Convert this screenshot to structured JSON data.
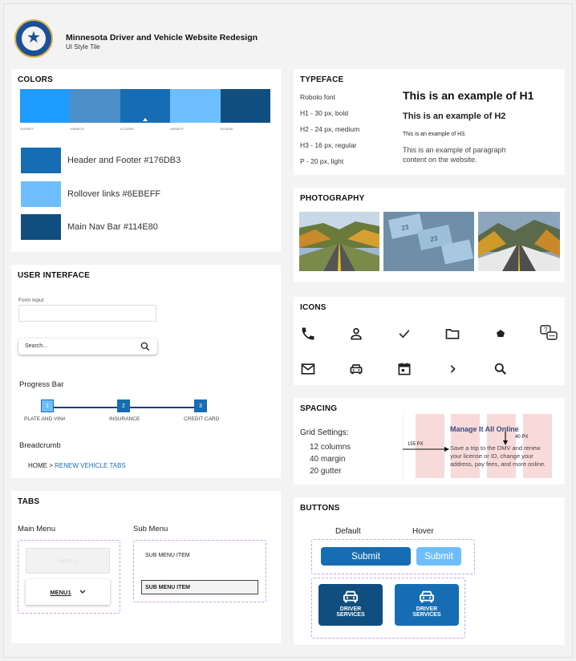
{
  "header": {
    "title": "Minnesota Driver and Vehicle Website Redesign",
    "subtitle": "UI Style Tile"
  },
  "colors": {
    "heading": "COLORS",
    "palette": [
      {
        "hex": "#1E9BFF",
        "label": "#1E9BFF"
      },
      {
        "hex": "#4B8EC8",
        "label": "#4B8EC8"
      },
      {
        "hex": "#176DB3",
        "label": "#176DB3"
      },
      {
        "hex": "#6EBEFF",
        "label": "#6EBEFF"
      },
      {
        "hex": "#114E80",
        "label": "#114E80"
      }
    ],
    "legend": [
      {
        "hex": "#176DB3",
        "label": "Header and Footer #176DB3"
      },
      {
        "hex": "#6EBEFF",
        "label": "Rollover links #6EBEFF"
      },
      {
        "hex": "#114E80",
        "label": "Main Nav Bar #114E80"
      }
    ]
  },
  "typeface": {
    "heading": "TYPEFACE",
    "specs": [
      "Roboto font",
      "H1 -  30 px, bold",
      "H2 - 24 px, medium",
      "H3 - 16 px, regular",
      "P - 20 px, light"
    ],
    "h1_example": "This is an example of H1",
    "h2_example": "This is an example of H2",
    "h3_example": "This is an example of H3.",
    "p_example": "This is an example of paragraph content on the website."
  },
  "photography": {
    "heading": "PHOTOGRAPHY"
  },
  "ui": {
    "heading": "USER INTERFACE",
    "form_label": "Form Input",
    "search_placeholder": "Search...",
    "progress_label": "Progress Bar",
    "steps": [
      {
        "num": "1",
        "label": "PLATE AND VIN#"
      },
      {
        "num": "2",
        "label": "INSURANCE"
      },
      {
        "num": "3",
        "label": "CREDIT CARD"
      }
    ],
    "breadcrumb_label": "Breadcrumb",
    "breadcrumb_home": "HOME > ",
    "breadcrumb_current": "RENEW VEHICLE TABS"
  },
  "icons": {
    "heading": "ICONS",
    "names": [
      "phone-icon",
      "user-icon",
      "check-icon",
      "folder-icon",
      "pentagon-icon",
      "chat-help-icon",
      "mail-icon",
      "car-icon",
      "calendar-icon",
      "chevron-right-icon",
      "search-icon"
    ]
  },
  "tabs": {
    "heading": "TABS",
    "main_label": "Main Menu",
    "sub_label": "Sub Menu",
    "menu1_faded": "MENU1",
    "menu1": "MENU1",
    "sub_item": "SUB MENU ITEM",
    "sub_item_active": "SUB MENU ITEM"
  },
  "spacing": {
    "heading": "SPACING",
    "grid_label": "Grid Settings:",
    "lines": [
      "12 columns",
      "40 margin",
      "20 gutter"
    ],
    "demo_title": "Manage It All Online",
    "demo_text": "Save a trip to the DMV and renew your license or ID, change your address, pay fees, and more online.",
    "dim_155": "155 PX",
    "dim_40": "40 PX"
  },
  "buttons": {
    "heading": "BUTTONS",
    "default_label": "Default",
    "hover_label": "Hover",
    "submit_default": "Submit",
    "submit_hover": "Submit",
    "driver_line1": "DRIVER",
    "driver_line2": "SERVICES"
  }
}
